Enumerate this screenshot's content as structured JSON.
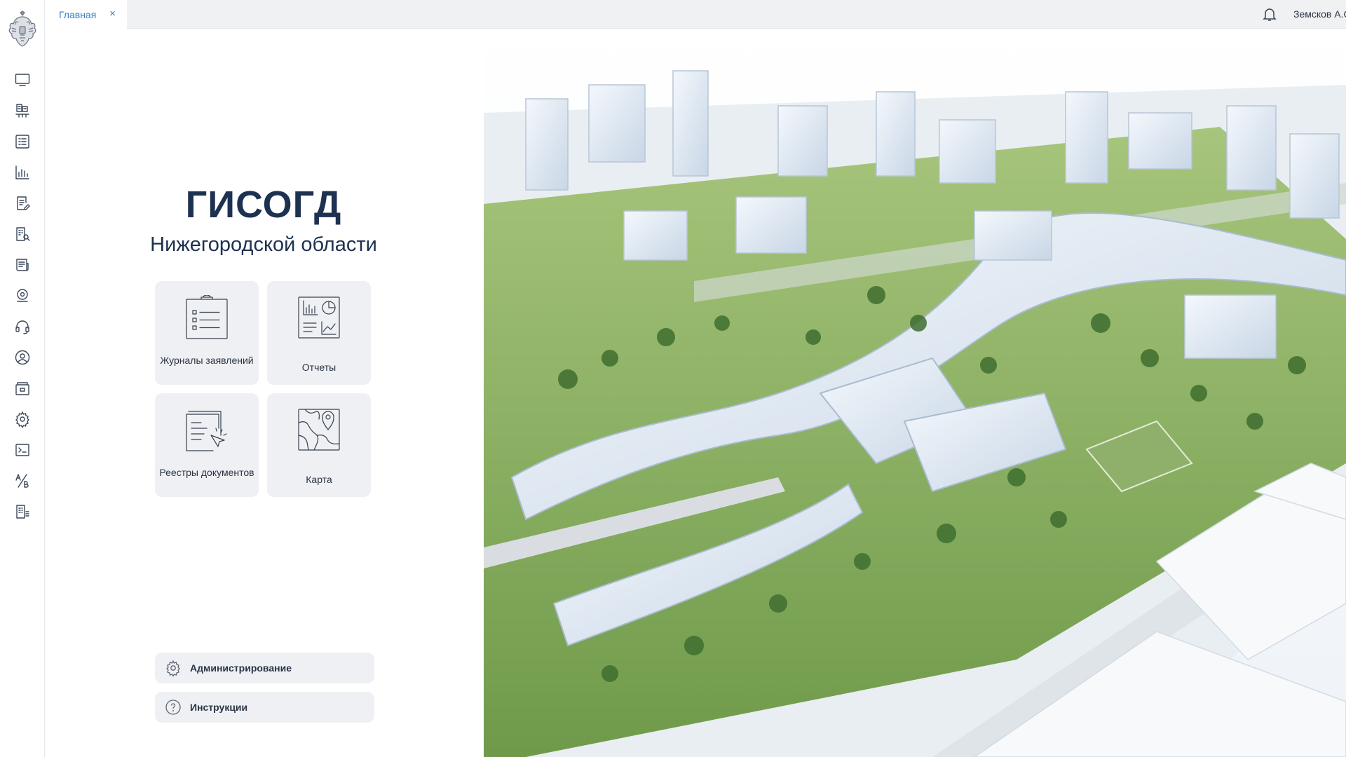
{
  "app": {
    "tab_label": "Главная",
    "tab_close": "×"
  },
  "header": {
    "user_name": "Земсков А.О."
  },
  "main": {
    "title": "ГИСОГД",
    "subtitle": "Нижегородской области"
  },
  "tiles": [
    {
      "label": "Журналы заявлений",
      "icon": "clipboard-list-icon"
    },
    {
      "label": "Отчеты",
      "icon": "report-charts-icon"
    },
    {
      "label": "Реестры документов",
      "icon": "document-registry-icon"
    },
    {
      "label": "Карта",
      "icon": "map-pin-icon"
    }
  ],
  "links": {
    "admin": "Администрирование",
    "instructions": "Инструкции"
  },
  "sidebar_icons": [
    "monitor-icon",
    "city-network-icon",
    "checklist-icon",
    "bar-chart-icon",
    "document-edit-icon",
    "building-search-icon",
    "news-icon",
    "location-icon",
    "headset-icon",
    "user-circle-icon",
    "archive-icon",
    "gear-icon",
    "terminal-icon",
    "translate-icon",
    "building-list-icon"
  ],
  "colors": {
    "accent": "#2f80d1",
    "title": "#1d3150",
    "tile_bg": "#eef0f3"
  }
}
